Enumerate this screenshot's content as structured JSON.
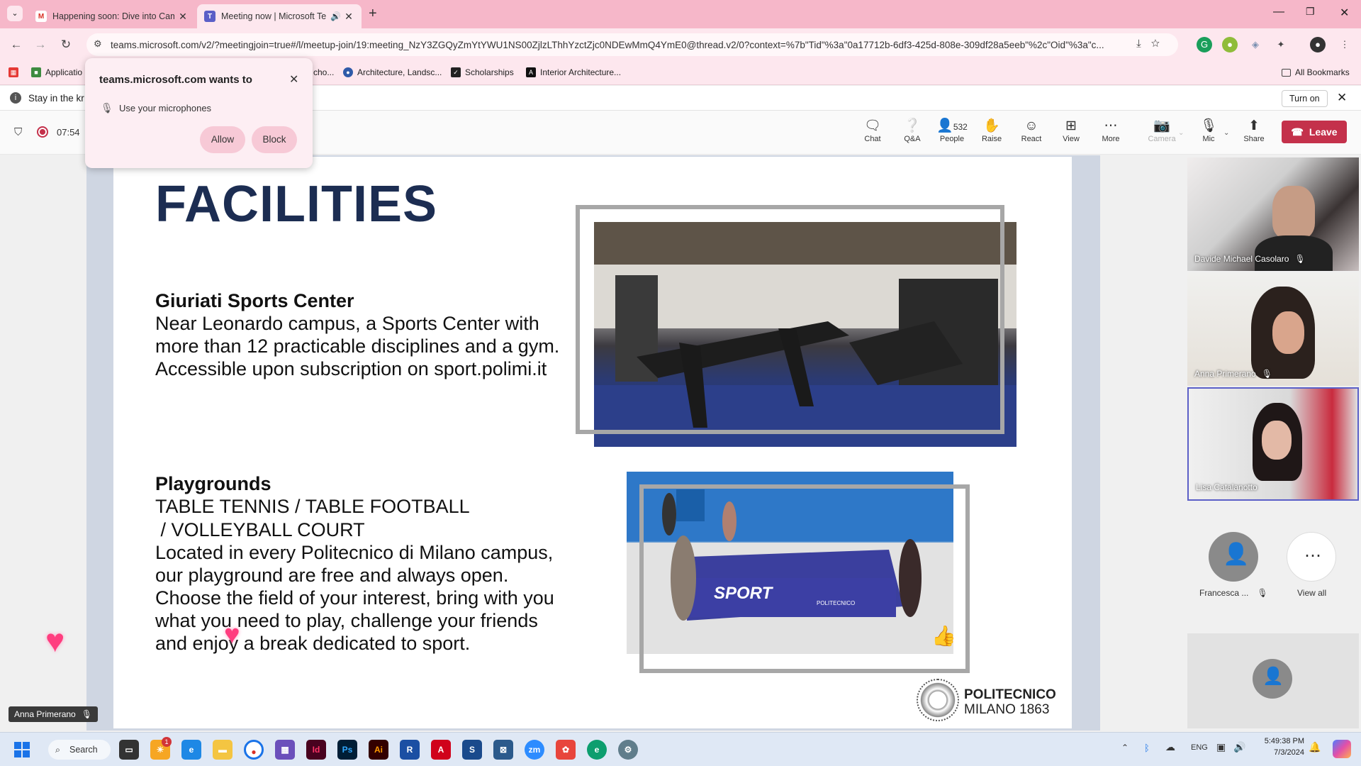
{
  "browser": {
    "tabs": [
      {
        "title": "Happening soon: Dive into Cam",
        "icon": "gmail-icon"
      },
      {
        "title": "Meeting now | Microsoft Te",
        "icon": "teams-icon",
        "active": true
      }
    ],
    "url": "teams.microsoft.com/v2/?meetingjoin=true#/l/meetup-join/19:meeting_NzY3ZGQyZmYtYWU1NS00ZjlzLThhYzctZjc0NDEwMmQ4YmE0@thread.v2/0?context=%7b\"Tid\"%3a\"0a17712b-6df3-425d-808e-309df28a5eeb\"%2c\"Oid\"%3a\"c...",
    "bookmarks": [
      "Applicatio",
      "...cho...",
      "Architecture, Landsc...",
      "Scholarships",
      "Interior Architecture..."
    ],
    "all_bookmarks": "All Bookmarks"
  },
  "permission_popup": {
    "title": "teams.microsoft.com wants to",
    "request": "Use your microphones",
    "allow": "Allow",
    "block": "Block"
  },
  "infobar": {
    "text": "Stay in the kr",
    "turn_on": "Turn on"
  },
  "meeting": {
    "timer": "07:54",
    "controls": {
      "chat": "Chat",
      "qa": "Q&A",
      "people": "People",
      "people_count": "532",
      "raise": "Raise",
      "react": "React",
      "view": "View",
      "more": "More",
      "camera": "Camera",
      "mic": "Mic",
      "share": "Share",
      "leave": "Leave"
    },
    "presenter": "Anna Primerano",
    "participants": [
      {
        "name": "Davide Michael Casolaro"
      },
      {
        "name": "Anna Primerano"
      },
      {
        "name": "Lisa Catalanotto"
      }
    ],
    "extra_participant": "Francesca ...",
    "view_all": "View all"
  },
  "slide": {
    "title": "FACILITIES",
    "section1_heading": "Giuriati Sports Center",
    "section1_lines": [
      "Near Leonardo campus, a Sports Center with",
      "more than 12 practicable disciplines and a gym.",
      "Accessible upon subscription on sport.polimi.it"
    ],
    "section2_heading": "Playgrounds",
    "section2_lines": [
      "TABLE TENNIS / TABLE FOOTBALL",
      " / VOLLEYBALL COURT",
      "Located in every Politecnico di Milano campus,",
      "our playground are free and always open.",
      "Choose the field of your interest, bring with you",
      "what you need to play, challenge your friends",
      "and enjoy a break dedicated to sport."
    ],
    "table_text": "SPORT",
    "table_brand": "POLITECNICO",
    "logo_line1": "POLITECNICO",
    "logo_line2": "MILANO 1863"
  },
  "taskbar": {
    "search": "Search",
    "lang": "ENG",
    "time": "5:49:38 PM",
    "date": "7/3/2024",
    "badge": "1"
  }
}
